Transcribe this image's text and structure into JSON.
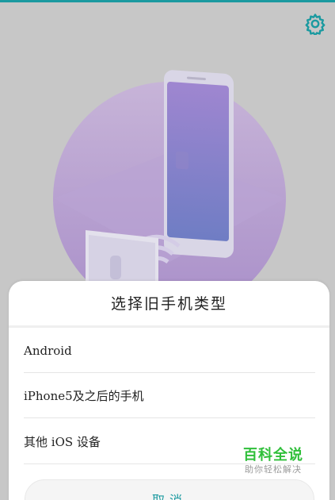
{
  "header": {
    "settings_icon": "gear-icon",
    "accent_color": "#1b9aa0"
  },
  "illustration": {
    "icon": "phone-transfer-illustration"
  },
  "dialog": {
    "title": "选择旧手机类型",
    "options": [
      {
        "label": "Android"
      },
      {
        "label": "iPhone5及之后的手机"
      },
      {
        "label": "其他 iOS 设备"
      }
    ],
    "cancel_label": "取消"
  },
  "watermark": {
    "main": "百科全说",
    "sub": "助你轻松解决"
  }
}
